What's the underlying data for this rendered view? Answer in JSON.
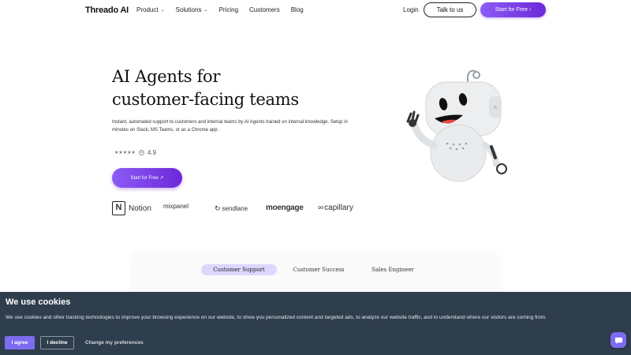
{
  "brand": "Threado AI",
  "nav": {
    "items": [
      {
        "label": "Product",
        "has_dropdown": true
      },
      {
        "label": "Solutions",
        "has_dropdown": true
      },
      {
        "label": "Pricing",
        "has_dropdown": false
      },
      {
        "label": "Customers",
        "has_dropdown": false
      },
      {
        "label": "Blog",
        "has_dropdown": false
      }
    ],
    "login": "Login",
    "talk": "Talk to us",
    "start": "Start for Free ›"
  },
  "hero": {
    "title_line1": "AI Agents for",
    "title_line2": "customer-facing teams",
    "subtitle": "Instant, automated support to customers and internal teams by AI Agents trained on internal knowledge. Setup in minutes on Slack, MS Teams, or as a Chrome app.",
    "stars": "★★★★★",
    "rating": "4.9",
    "cta": "Start for Free ↗"
  },
  "logos": {
    "notion": "Notion",
    "mixpanel": "mixpanel",
    "sendlane": "sendlane",
    "moengage": "moengage",
    "capillary": "capillary"
  },
  "tabs": [
    {
      "label": "Customer Support",
      "active": true
    },
    {
      "label": "Customer Success",
      "active": false
    },
    {
      "label": "Sales Engineer",
      "active": false
    }
  ],
  "cookie": {
    "title": "We use cookies",
    "text": "We use cookies and other tracking technologies to improve your browsing experience on our website, to show you personalized content and targeted ads, to analyze our website traffic, and to understand where our visitors are coming from.",
    "agree": "I agree",
    "decline": "I decline",
    "prefs": "Change my preferences"
  },
  "colors": {
    "accent": "#7c3aed",
    "cookie_bg": "#2f3e4d",
    "tab_active": "#ddd6fe"
  }
}
